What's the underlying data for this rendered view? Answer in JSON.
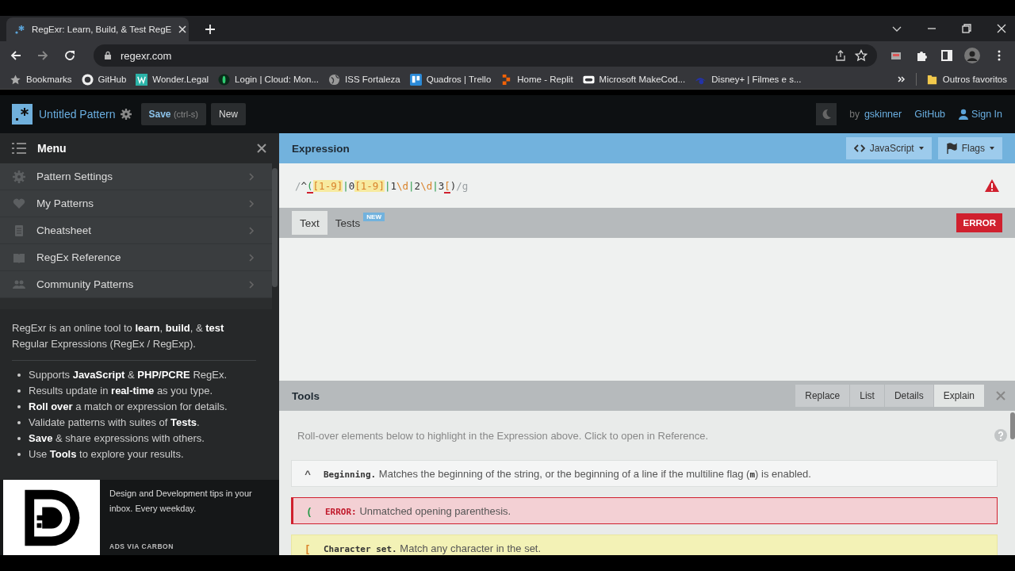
{
  "browser": {
    "tab_title": "RegExr: Learn, Build, & Test RegE",
    "address": "regexr.com",
    "bookmarks": [
      "Bookmarks",
      "GitHub",
      "Wonder.Legal",
      "Login | Cloud: Mon...",
      "ISS Fortaleza",
      "Quadros | Trello",
      "Home - Replit",
      "Microsoft MakeCod...",
      "Disney+ | Filmes e s..."
    ],
    "other_bookmarks": "Outros favoritos"
  },
  "app": {
    "title": "Untitled Pattern",
    "save": "Save",
    "save_hint": "(ctrl-s)",
    "new": "New",
    "by": "by",
    "author": "gskinner",
    "github": "GitHub",
    "sign_in": "Sign In"
  },
  "sidebar": {
    "title": "Menu",
    "items": [
      "Pattern Settings",
      "My Patterns",
      "Cheatsheet",
      "RegEx Reference",
      "Community Patterns"
    ],
    "intro": "RegExr is an online tool to **learn**, **build**, & **test** Regular Expressions (RegEx / RegExp).",
    "features": [
      "Supports **JavaScript** & **PHP/PCRE** RegEx.",
      "Results update in **real-time** as you type.",
      "**Roll over** a match or expression for details.",
      "Validate patterns with suites of **Tests**.",
      "**Save** & share expressions with others.",
      "Use **Tools** to explore your results."
    ],
    "ad": {
      "text": "Design and Development tips in your inbox. Every weekday.",
      "footer": "ADS VIA CARBON"
    }
  },
  "expression": {
    "title": "Expression",
    "flavor": "JavaScript",
    "flags": "Flags",
    "tokens": [
      {
        "text": "/",
        "kind": "delim",
        "error": false
      },
      {
        "text": "^",
        "kind": "anchor",
        "error": false
      },
      {
        "text": "(",
        "kind": "group",
        "error": true
      },
      {
        "text": "[1-9]",
        "kind": "set",
        "error": false
      },
      {
        "text": "|",
        "kind": "alt",
        "error": false
      },
      {
        "text": "0",
        "kind": "literal",
        "error": false
      },
      {
        "text": "[1-9]",
        "kind": "set",
        "error": false
      },
      {
        "text": "|",
        "kind": "alt",
        "error": false
      },
      {
        "text": "1",
        "kind": "literal",
        "error": false
      },
      {
        "text": "\\d",
        "kind": "escape",
        "error": false
      },
      {
        "text": "|",
        "kind": "alt",
        "error": false
      },
      {
        "text": "2",
        "kind": "literal",
        "error": false
      },
      {
        "text": "\\d",
        "kind": "escape",
        "error": false
      },
      {
        "text": "|",
        "kind": "alt",
        "error": false
      },
      {
        "text": "3",
        "kind": "literal",
        "error": false
      },
      {
        "text": "[",
        "kind": "escape",
        "error": true
      },
      {
        "text": ")",
        "kind": "literal",
        "error": false
      },
      {
        "text": "/g",
        "kind": "delim",
        "error": false
      }
    ]
  },
  "text_panel": {
    "tabs": [
      {
        "label": "Text",
        "selected": true
      },
      {
        "label": "Tests",
        "selected": false,
        "badge": "NEW"
      }
    ],
    "status": "ERROR"
  },
  "tools": {
    "title": "Tools",
    "tabs": [
      {
        "label": "Replace",
        "selected": false
      },
      {
        "label": "List",
        "selected": false
      },
      {
        "label": "Details",
        "selected": false
      },
      {
        "label": "Explain",
        "selected": true
      }
    ],
    "hint": "Roll-over elements below to highlight in the Expression above. Click to open in Reference.",
    "items": [
      {
        "kind": "normal",
        "token": "^",
        "title": "Beginning.",
        "text": "Matches the beginning of the string, or the beginning of a line if the multiline flag (**m**) is enabled."
      },
      {
        "kind": "error",
        "token": "(",
        "title": "ERROR:",
        "text": "Unmatched opening parenthesis."
      },
      {
        "kind": "set",
        "token": "[",
        "title": "Character set.",
        "text": "Match any character in the set."
      }
    ]
  }
}
